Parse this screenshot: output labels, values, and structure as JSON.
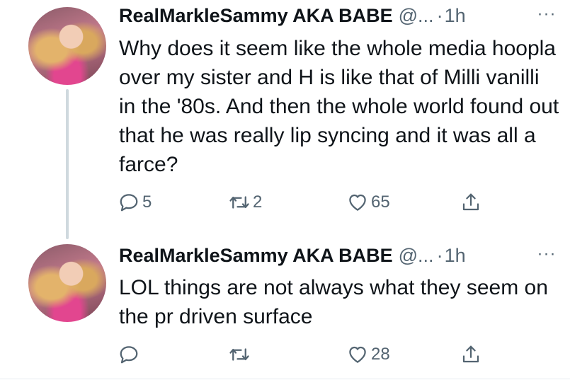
{
  "tweets": [
    {
      "display_name": "RealMarkleSammy AKA BABE",
      "handle": "@...",
      "separator": "·",
      "time": "1h",
      "more": "···",
      "text": "Why does it seem like the whole media hoopla over my sister and H is like that of Milli vanilli in the '80s. And then the whole world found out that he was really lip syncing and it was all a farce?",
      "replies": "5",
      "retweets": "2",
      "likes": "65"
    },
    {
      "display_name": "RealMarkleSammy AKA BABE",
      "handle": "@...",
      "separator": "·",
      "time": "1h",
      "more": "···",
      "text": "LOL things are not always what they seem on the pr driven surface",
      "replies": "",
      "retweets": "",
      "likes": "28"
    }
  ],
  "icons": {
    "reply": "reply-icon",
    "retweet": "retweet-icon",
    "like": "heart-icon",
    "share": "share-icon"
  },
  "colors": {
    "text": "#0f1419",
    "secondary": "#536471",
    "thread_line": "#cfd9de"
  }
}
